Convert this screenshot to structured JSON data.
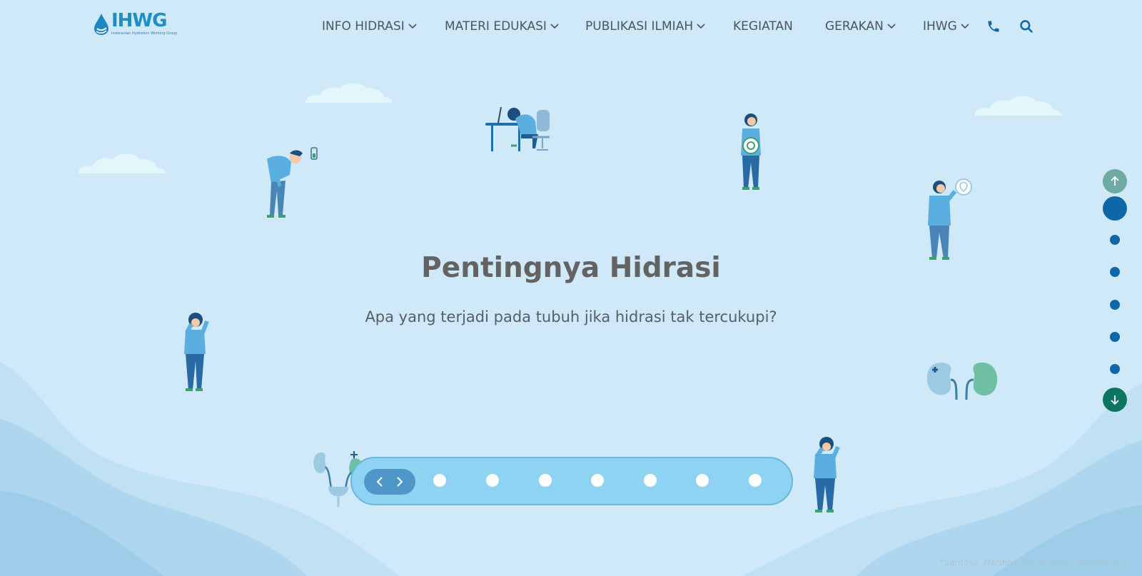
{
  "brand": {
    "name": "IHWG",
    "tagline": "Indonesian Hydration Working Group"
  },
  "nav": {
    "items": [
      {
        "label": "INFO HIDRASI",
        "has_dropdown": true
      },
      {
        "label": "MATERI EDUKASI",
        "has_dropdown": true
      },
      {
        "label": "PUBLIKASI ILMIAH",
        "has_dropdown": true
      },
      {
        "label": "KEGIATAN",
        "has_dropdown": false
      },
      {
        "label": "GERAKAN",
        "has_dropdown": true
      },
      {
        "label": "IHWG",
        "has_dropdown": true
      }
    ],
    "icons": [
      "phone-icon",
      "search-icon"
    ]
  },
  "hero": {
    "title": "Pentingnya Hidrasi",
    "subtitle": "Apa yang terjadi pada tubuh jika hidrasi tak tercukupi?"
  },
  "slider": {
    "dot_count": 7,
    "prev_icon": "chevron-left-icon",
    "next_icon": "chevron-right-icon"
  },
  "side_nav": {
    "dot_count": 6,
    "active_index": 0
  },
  "footnote": "*Santoso, Hardinsyah, Siregar, Pardede 2017",
  "colors": {
    "background": "#cfe9f8",
    "primary_blue": "#0f66a8",
    "accent_green": "#0e7560",
    "slider_fill": "#8fd3f2",
    "title_gray": "#636363"
  }
}
